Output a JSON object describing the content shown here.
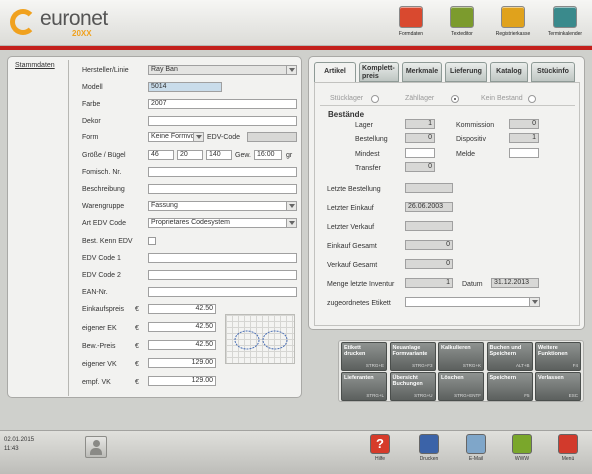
{
  "header": {
    "logo_text": "euronet",
    "logo_sub": "20XX",
    "buttons": [
      {
        "label": "Formdaten",
        "icon": "glasses-icon",
        "color": "#d9492f"
      },
      {
        "label": "Texteditor",
        "icon": "edit-icon",
        "color": "#7c9b2d"
      },
      {
        "label": "Registrierkasse",
        "icon": "cash-register-icon",
        "color": "#e0a21c"
      },
      {
        "label": "Terminkalender",
        "icon": "calendar-icon",
        "color": "#3a8a8c"
      }
    ]
  },
  "stammdaten": {
    "tab_label": "Stammdaten",
    "hersteller_label": "Hersteller/Linie",
    "hersteller_value": "Ray Ban",
    "modell_label": "Modell",
    "modell_value": "5014",
    "farbe_label": "Farbe",
    "farbe_value": "2007",
    "dekor_label": "Dekor",
    "dekor_value": "",
    "form_label": "Form",
    "form_value": "Keine Formvo",
    "edv_code_label": "EDV-Code",
    "edv_code_value": "",
    "groesse_label": "Größe / Bügel",
    "groesse_value": "46",
    "steg_value": "20",
    "buegel_value": "140",
    "gew_label": "Gew.",
    "gew_value": "16:00",
    "gew_unit": "gr",
    "fomisch_label": "Fomisch. Nr.",
    "fomisch_value": "",
    "beschreibung_label": "Beschreibung",
    "beschreibung_value": "",
    "warengruppe_label": "Warengruppe",
    "warengruppe_value": "Fassung",
    "art_edv_label": "Art EDV Code",
    "art_edv_value": "Proprietares Codesystem",
    "best_kenn_label": "Best. Kenn EDV",
    "edv1_label": "EDV Code 1",
    "edv1_value": "",
    "edv2_label": "EDV Code 2",
    "edv2_value": "",
    "ean_label": "EAN-Nr.",
    "ean_value": "",
    "einkaufspreis_label": "Einkaufspreis",
    "einkaufspreis_value": "42.50",
    "eigener_ek_label": "eigener EK",
    "eigener_ek_value": "42.50",
    "bew_preis_label": "Bew.-Preis",
    "bew_preis_value": "42.50",
    "eigener_vk_label": "eigener VK",
    "eigener_vk_value": "129.00",
    "empf_vk_label": "empf. VK",
    "empf_vk_value": "129.00",
    "currency": "€"
  },
  "artikel": {
    "tabs": [
      "Artikel",
      "Komplett-\npreis",
      "Merkmale",
      "Lieferung",
      "Katalog",
      "Stückinfo"
    ],
    "radio_stuck": "Stücklager",
    "radio_zahl": "Zähllager",
    "radio_kein": "Kein Bestand",
    "bestaende_label": "Bestände",
    "lager_label": "Lager",
    "lager_value": "1",
    "bestellung_label": "Bestellung",
    "bestellung_value": "0",
    "mindest_label": "Mindest",
    "mindest_value": "",
    "transfer_label": "Transfer",
    "transfer_value": "0",
    "kommission_label": "Kommission",
    "kommission_value": "0",
    "dispositiv_label": "Dispositiv",
    "dispositiv_value": "1",
    "melde_label": "Melde",
    "melde_value": "",
    "letzte_bestellung_label": "Letzte Bestellung",
    "letzte_bestellung_value": "",
    "letzter_einkauf_label": "Letzter Einkauf",
    "letzter_einkauf_value": "26.06.2003",
    "letzter_verkauf_label": "Letzter Verkauf",
    "letzter_verkauf_value": "",
    "einkauf_gesamt_label": "Einkauf Gesamt",
    "einkauf_gesamt_value": "0",
    "verkauf_gesamt_label": "Verkauf Gesamt",
    "verkauf_gesamt_value": "0",
    "inventur_label": "Menge letzte Inventur",
    "inventur_value": "1",
    "datum_label": "Datum",
    "datum_value": "31.12.2013",
    "etikett_label": "zugeordnetes Etikett",
    "etikett_value": ""
  },
  "functions": [
    {
      "label": "Etikett\ndrucken",
      "key": "STRG+E"
    },
    {
      "label": "Neuanlage\nFormvariante",
      "key": "STRG+F3"
    },
    {
      "label": "Kalkulieren",
      "key": "STRG+K"
    },
    {
      "label": "Buchen und\nSpeichern",
      "key": "ALT+B"
    },
    {
      "label": "Weitere\nFunktionen",
      "key": "F4"
    },
    {
      "label": "Lieferanten",
      "key": "STRG+L"
    },
    {
      "label": "Übersicht\nBuchungen",
      "key": "STRG+U"
    },
    {
      "label": "Löschen",
      "key": "STRG+ENTF"
    },
    {
      "label": "Speichern",
      "key": "F5"
    },
    {
      "label": "Verlassen",
      "key": "ESC"
    }
  ],
  "footer": {
    "date": "02.01.2015",
    "time": "11:43",
    "buttons": [
      {
        "label": "Hilfe",
        "icon": "help-icon",
        "color": "#d63b2a"
      },
      {
        "label": "Drucken",
        "icon": "printer-icon",
        "color": "#3b63a8"
      },
      {
        "label": "E-Mail",
        "icon": "mail-icon",
        "color": "#7fa6c9"
      },
      {
        "label": "WWW",
        "icon": "globe-icon",
        "color": "#7aa72b"
      },
      {
        "label": "Menü",
        "icon": "menu-icon",
        "color": "#d23a2c"
      }
    ]
  }
}
